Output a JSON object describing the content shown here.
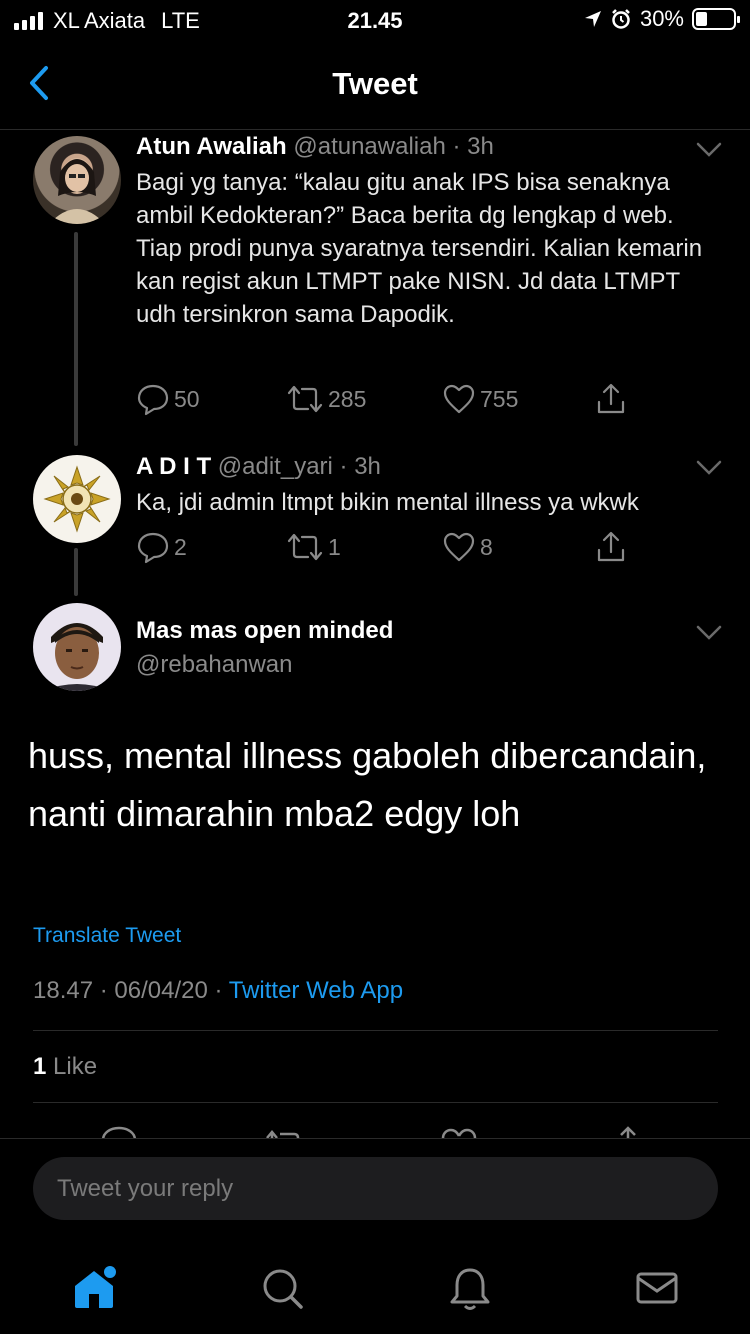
{
  "status": {
    "carrier": "XL Axiata",
    "network": "LTE",
    "time": "21.45",
    "battery": "30%",
    "battery_level": 0.3
  },
  "nav": {
    "title": "Tweet"
  },
  "thread": [
    {
      "name": "Atun Awaliah",
      "handle": "@atunawaliah",
      "sep": "·",
      "age": "3h",
      "text": "Bagi yg tanya: “kalau gitu anak IPS bisa senaknya ambil Kedokteran?” Baca berita dg lengkap d web. Tiap prodi punya syaratnya tersendiri. Kalian kemarin kan regist akun LTMPT pake NISN. Jd data LTMPT udh tersinkron sama Dapodik.",
      "replies": "50",
      "retweets": "285",
      "likes": "755"
    },
    {
      "name": "A D I T",
      "handle": "@adit_yari",
      "sep": "·",
      "age": "3h",
      "text": "Ka, jdi admin ltmpt bikin mental illness ya wkwk",
      "replies": "2",
      "retweets": "1",
      "likes": "8"
    }
  ],
  "main_tweet": {
    "name": "Mas mas open minded",
    "handle": "@rebahanwan",
    "text": "huss, mental illness gaboleh dibercandain, nanti dimarahin mba2 edgy loh",
    "translate": "Translate Tweet",
    "time": "18.47",
    "date": "06/04/20",
    "sep": "·",
    "source": "Twitter Web App",
    "like_count": "1",
    "like_label": "Like"
  },
  "compose": {
    "placeholder": "Tweet your reply"
  },
  "tabs": [
    "home-icon",
    "search-icon",
    "notifications-icon",
    "messages-icon"
  ],
  "colors": {
    "accent": "#1d9bf0",
    "background": "#000000",
    "muted": "#8a8a8a"
  }
}
